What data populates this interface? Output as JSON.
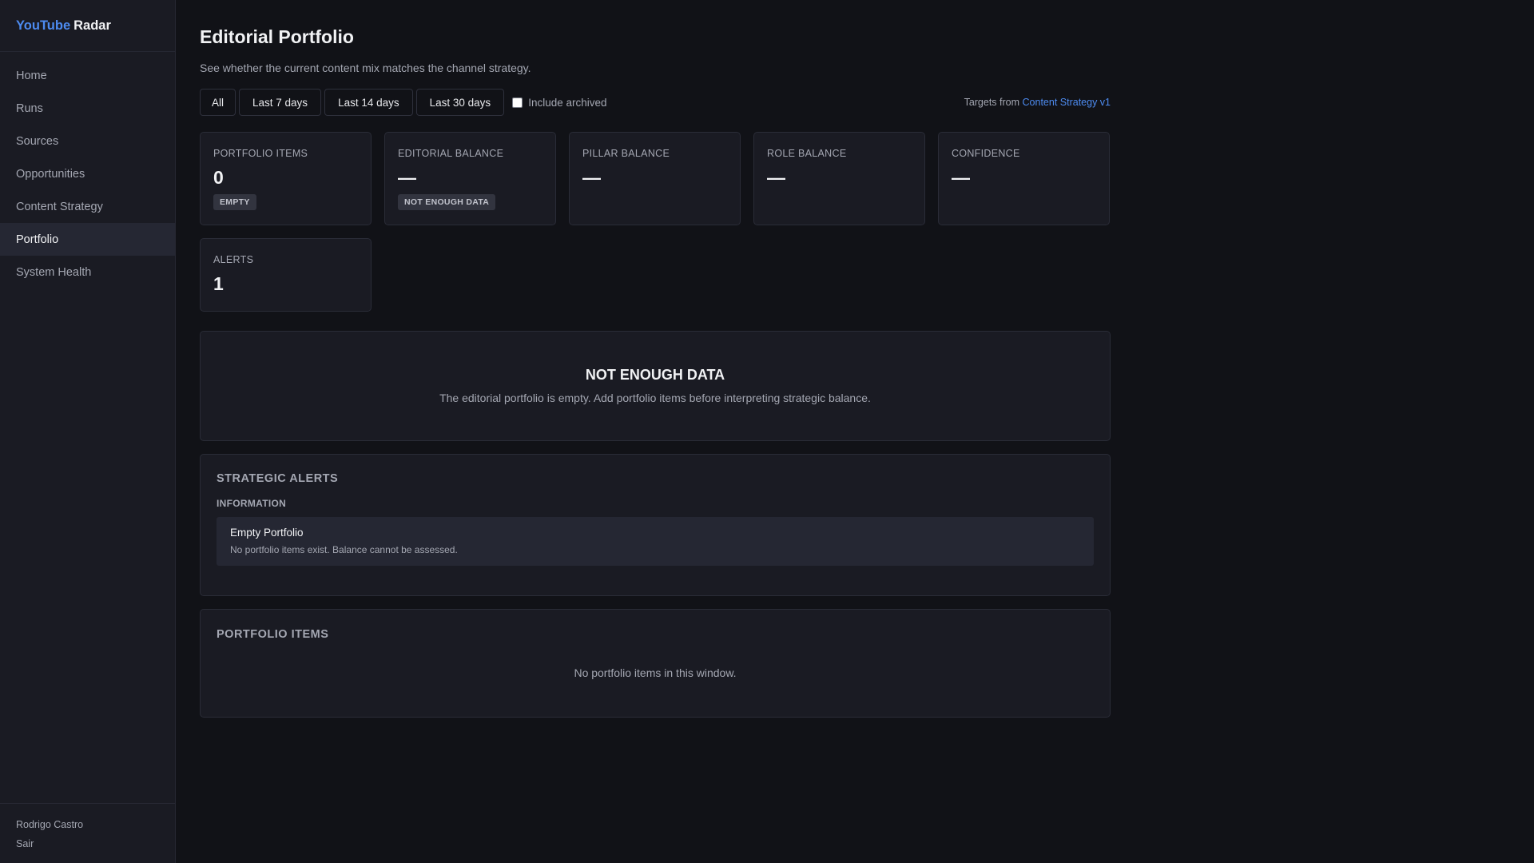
{
  "brand": {
    "part1": "YouTube",
    "part2": "Radar"
  },
  "nav": {
    "home": "Home",
    "runs": "Runs",
    "sources": "Sources",
    "opportunities": "Opportunities",
    "content_strategy": "Content Strategy",
    "portfolio": "Portfolio",
    "system_health": "System Health"
  },
  "user": {
    "name": "Rodrigo Castro",
    "logout": "Sair"
  },
  "page": {
    "title": "Editorial Portfolio",
    "subtitle": "See whether the current content mix matches the channel strategy."
  },
  "filters": {
    "all": "All",
    "last7": "Last 7 days",
    "last14": "Last 14 days",
    "last30": "Last 30 days",
    "include_archived": "Include archived",
    "include_archived_checked": false,
    "targets_prefix": "Targets from",
    "targets_link": "Content Strategy v1"
  },
  "cards": {
    "portfolio_items": {
      "label": "PORTFOLIO ITEMS",
      "value": "0",
      "badge": "EMPTY"
    },
    "editorial_balance": {
      "label": "EDITORIAL BALANCE",
      "value": "—",
      "badge": "NOT ENOUGH DATA"
    },
    "pillar_balance": {
      "label": "PILLAR BALANCE",
      "value": "—"
    },
    "role_balance": {
      "label": "ROLE BALANCE",
      "value": "—"
    },
    "confidence": {
      "label": "CONFIDENCE",
      "value": "—"
    },
    "alerts": {
      "label": "ALERTS",
      "value": "1"
    }
  },
  "empty_state": {
    "title": "NOT ENOUGH DATA",
    "text": "The editorial portfolio is empty. Add portfolio items before interpreting strategic balance."
  },
  "strategic_alerts": {
    "title": "STRATEGIC ALERTS",
    "group": "INFORMATION",
    "items": [
      {
        "title": "Empty Portfolio",
        "description": "No portfolio items exist. Balance cannot be assessed."
      }
    ]
  },
  "portfolio_items": {
    "title": "PORTFOLIO ITEMS",
    "empty": "No portfolio items in this window."
  },
  "colors": {
    "background": "#111217",
    "surface": "#1a1b23",
    "accent": "#4d8bf0",
    "muted_text": "#a4a7b2"
  }
}
